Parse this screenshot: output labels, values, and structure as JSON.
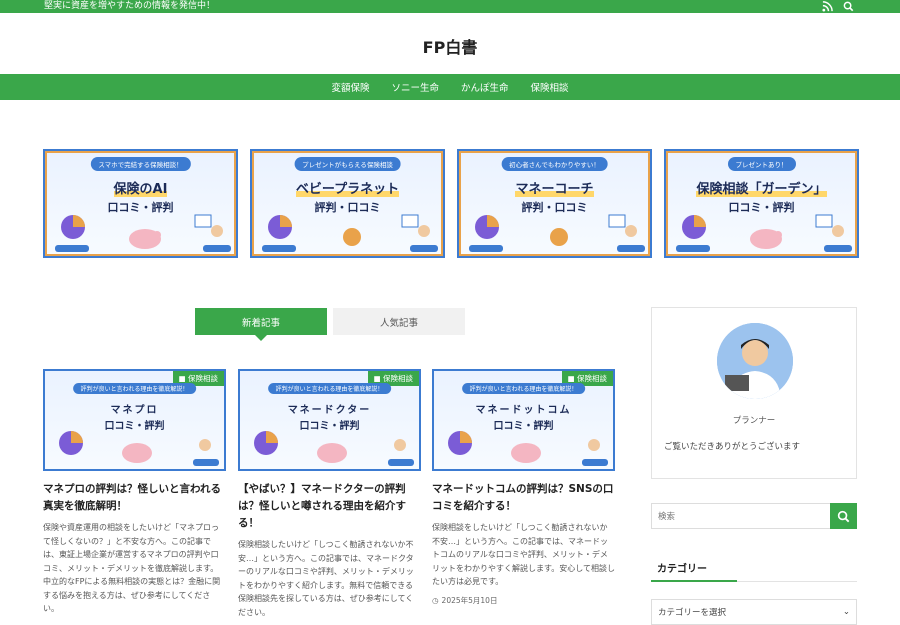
{
  "topbar": {
    "tagline": "堅実に資産を増やすための情報を発信中！"
  },
  "site": {
    "title": "FP白書"
  },
  "nav": {
    "items": [
      "変額保険",
      "ソニー生命",
      "かんぽ生命",
      "保険相談"
    ]
  },
  "banners": [
    {
      "pill": "スマホで完結する保険相談！",
      "title": "保険のAI",
      "sub": "口コミ・評判"
    },
    {
      "pill": "プレゼントがもらえる保険相談",
      "title": "ベビープラネット",
      "sub": "評判・口コミ"
    },
    {
      "pill": "初心者さんでもわかりやすい！",
      "title": "マネーコーチ",
      "sub": "評判・口コミ"
    },
    {
      "pill": "プレゼントあり！",
      "title": "保険相談「ガーデン」",
      "sub": "口コミ・評判"
    }
  ],
  "tabs": {
    "new": "新着記事",
    "popular": "人気記事"
  },
  "cards": [
    {
      "category": "保険相談",
      "pill": "評判が良いと言われる理由を徹底解説！",
      "thumb_title": "マネプロ",
      "thumb_sub": "口コミ・評判",
      "title": "マネプロの評判は？怪しいと言われる真実を徹底解明！",
      "excerpt": "保険や資産運用の相談をしたいけど「マネプロって怪しくないの？」と不安な方へ。この記事では、東証上場企業が運営するマネプロの評判や口コミ、メリット・デメリットを徹底解説します。中立的なFPによる無料相談の実態とは？金融に関する悩みを抱える方は、ぜひ参考にしてください。",
      "date": ""
    },
    {
      "category": "保険相談",
      "pill": "評判が良いと言われる理由を徹底解説！",
      "thumb_title": "マネードクター",
      "thumb_sub": "口コミ・評判",
      "title": "【やばい？】マネードクターの評判は？怪しいと噂される理由を紹介する！",
      "excerpt": "保険相談したいけど「しつこく勧誘されないか不安…」という方へ。この記事では、マネードクターのリアルな口コミや評判、メリット・デメリットをわかりやすく紹介します。無料で信頼できる保険相談先を探している方は、ぜひ参考にしてください。",
      "date": ""
    },
    {
      "category": "保険相談",
      "pill": "評判が良いと言われる理由を徹底解説！",
      "thumb_title": "マネードットコム",
      "thumb_sub": "口コミ・評判",
      "title": "マネードットコムの評判は？SNSの口コミを紹介する！",
      "excerpt": "保険相談をしたいけど「しつこく勧誘されないか不安…」という方へ。この記事では、マネードットコムのリアルな口コミや評判、メリット・デメリットをわかりやすく解説します。安心して相談したい方は必見です。",
      "date": "2025年5月10日"
    }
  ],
  "sidebar": {
    "profile_name": "プランナー",
    "profile_desc": "ご覧いただきありがとうございます",
    "search_placeholder": "検索",
    "category_heading": "カテゴリー",
    "category_select": "カテゴリーを選択"
  },
  "colors": {
    "brand_green": "#3aa74a",
    "banner_blue": "#3c7bd1",
    "banner_orange": "#e9a24a"
  }
}
